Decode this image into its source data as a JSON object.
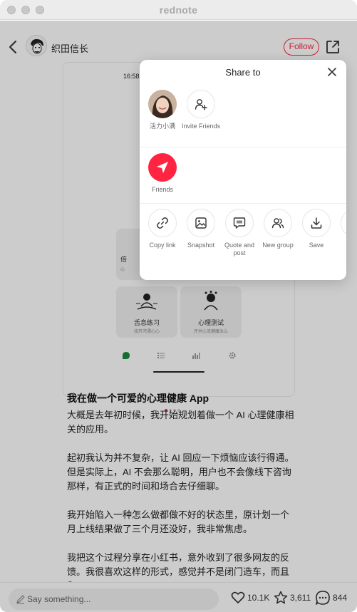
{
  "window": {
    "title": "rednote"
  },
  "header": {
    "author_name": "织田信长",
    "follow_label": "Follow"
  },
  "phone": {
    "time": "16:58"
  },
  "cards": [
    {
      "title": "倍",
      "subtitle": "心"
    },
    {
      "title": "舌息练习",
      "subtitle": "找开河漂心心"
    },
    {
      "title": "心理测试",
      "subtitle": "评并心流健康泳么"
    }
  ],
  "post": {
    "title": "我在做一个可爱的心理健康 App",
    "paragraphs": [
      "大概是去年初时候，我开始规划着做一个 AI 心理健康相关的应用。",
      "起初我认为并不复杂，让 AI 回应一下烦恼应该行得通。但是实际上，AI 不会那么聪明，用户也不会像线下咨询那样，有正式的时间和场合去仔细聊。",
      "我开始陷入一种怎么做都做不好的状态里，原计划一个月上线结果做了三个月还没好，我非常焦虑。",
      "我把这个过程分享在小红书，意外收到了很多网友的反馈。我很喜欢这样的形式，感觉并不是闭门造车，而且和"
    ]
  },
  "bottom_bar": {
    "comment_placeholder": "Say something...",
    "likes": "10.1K",
    "favorites": "3,611",
    "comments": "844"
  },
  "share_sheet": {
    "title": "Share to",
    "contacts": [
      {
        "label": "活力小满"
      },
      {
        "label": "Invite Friends"
      }
    ],
    "friends_label": "Friends",
    "actions": [
      {
        "label": "Copy link",
        "icon": "link-icon"
      },
      {
        "label": "Snapshot",
        "icon": "image-icon"
      },
      {
        "label": "Quote and post",
        "icon": "quote-icon"
      },
      {
        "label": "New group",
        "icon": "group-icon"
      },
      {
        "label": "Save",
        "icon": "download-icon"
      }
    ]
  },
  "colors": {
    "accent": "#ff2442"
  }
}
